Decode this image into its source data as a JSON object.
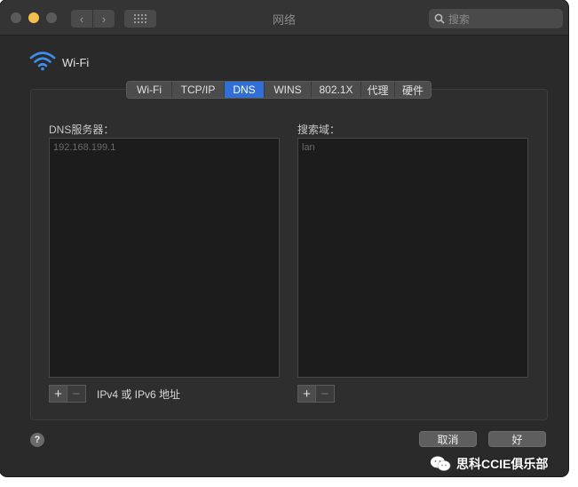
{
  "window": {
    "title": "网络"
  },
  "search": {
    "placeholder": "搜索"
  },
  "service": {
    "name": "Wi-Fi"
  },
  "tabs": [
    {
      "label": "Wi-Fi",
      "active": false
    },
    {
      "label": "TCP/IP",
      "active": false
    },
    {
      "label": "DNS",
      "active": true
    },
    {
      "label": "WINS",
      "active": false
    },
    {
      "label": "802.1X",
      "active": false
    },
    {
      "label": "代理",
      "active": false
    },
    {
      "label": "硬件",
      "active": false
    }
  ],
  "dns": {
    "label": "DNS服务器：",
    "servers": [
      "192.168.199.1"
    ],
    "hint": "IPv4 或 IPv6 地址"
  },
  "search_domains": {
    "label": "搜索域：",
    "domains": [
      "lan"
    ]
  },
  "controls": {
    "add": "+",
    "remove": "−"
  },
  "help": {
    "label": "?"
  },
  "buttons": {
    "cancel": "取消",
    "ok": "好"
  },
  "watermark": {
    "text": "思科CCIE俱乐部"
  },
  "colors": {
    "accent": "#2f6fd6",
    "background": "#2a2a2a",
    "minimize": "#f4bf4f"
  }
}
